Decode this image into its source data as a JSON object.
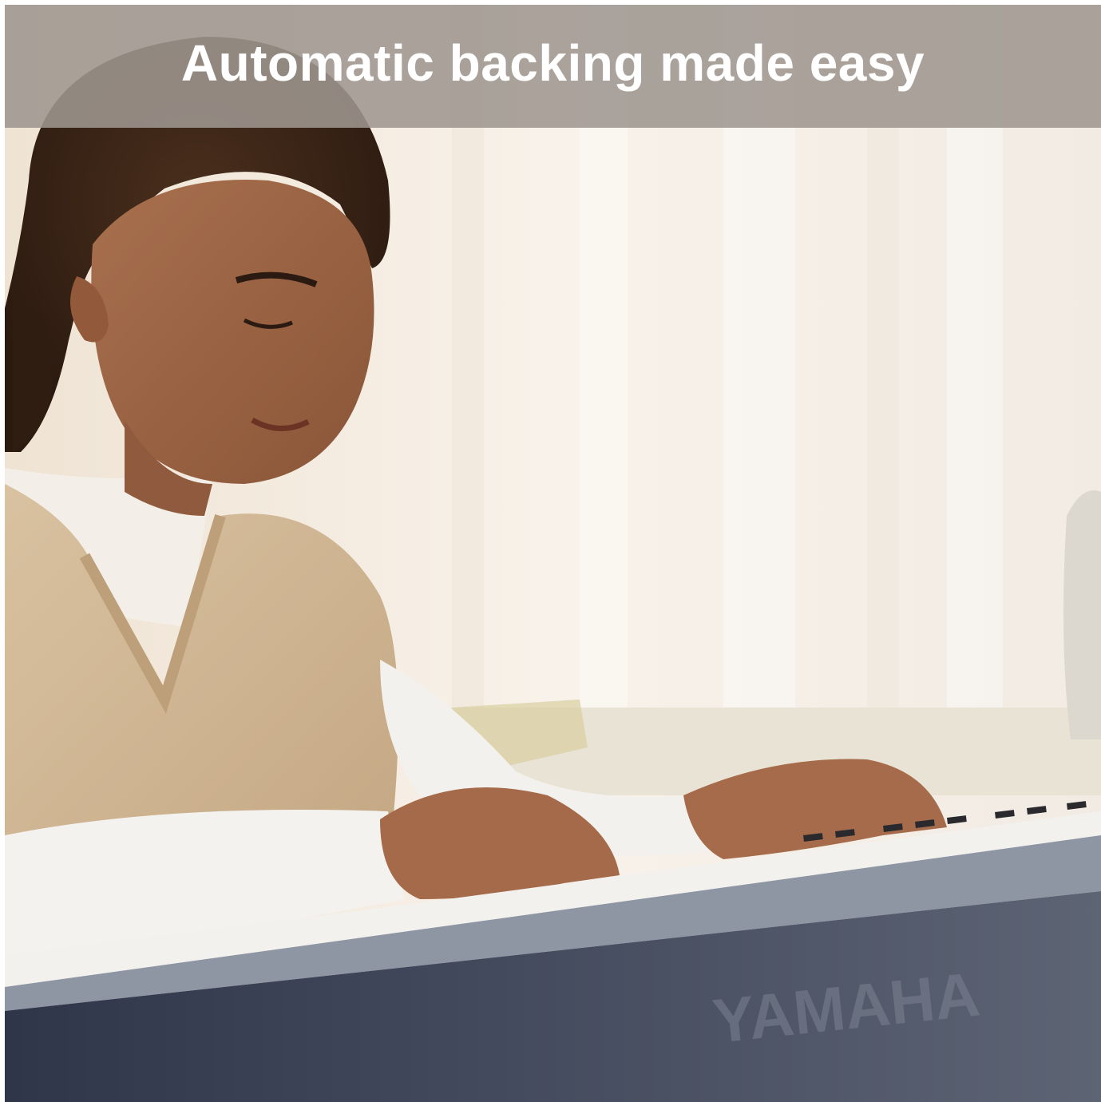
{
  "banner": {
    "title": "Automatic backing made easy"
  },
  "photo": {
    "brand_logo_text": "YAMAHA"
  },
  "colors": {
    "banner_overlay": "#9e968f",
    "banner_text": "#ffffff",
    "curtain_light": "#f6efe6",
    "sweater_vest": "#cfb593",
    "shirt": "#f4f1ec",
    "keyboard_body": "#3f4657",
    "hair": "#3b2517"
  }
}
